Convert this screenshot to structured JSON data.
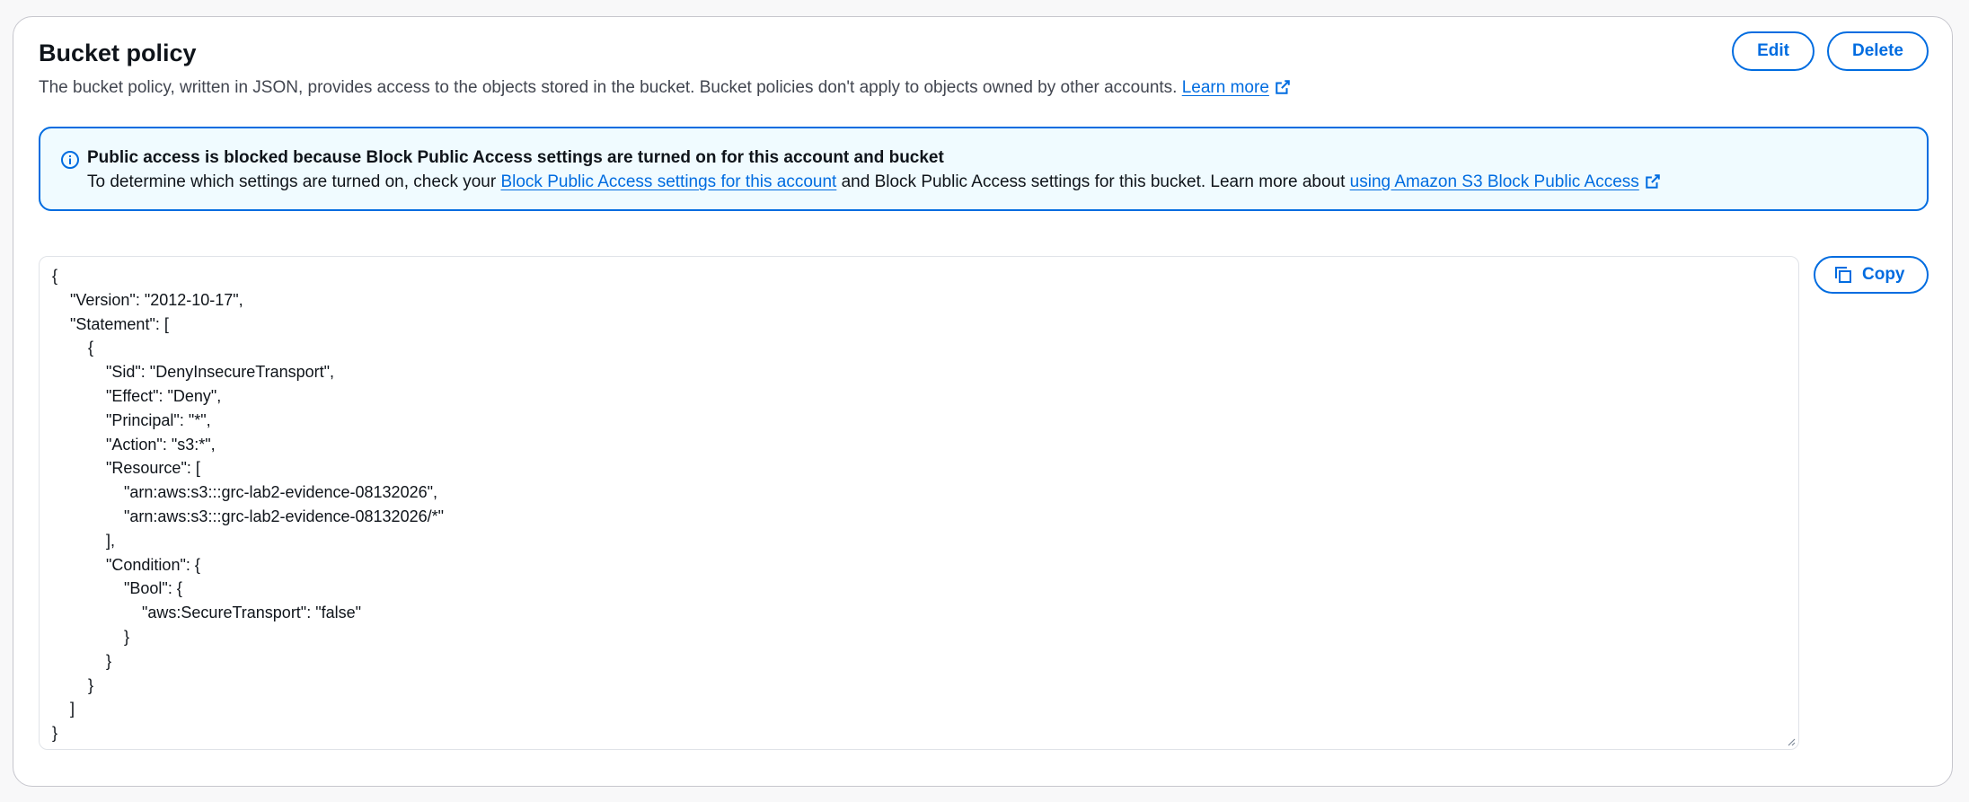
{
  "panel": {
    "title": "Bucket policy",
    "description": "The bucket policy, written in JSON, provides access to the objects stored in the bucket. Bucket policies don't apply to objects owned by other accounts.",
    "learn_more": "Learn more",
    "edit_label": "Edit",
    "delete_label": "Delete"
  },
  "alert": {
    "title": "Public access is blocked because Block Public Access settings are turned on for this account and bucket",
    "body_prefix": "To determine which settings are turned on, check your",
    "link_account": "Block Public Access settings for this account",
    "body_middle": "and Block Public Access settings for this bucket. Learn more about",
    "link_s3": "using Amazon S3 Block Public Access"
  },
  "policy": {
    "json": "{\n    \"Version\": \"2012-10-17\",\n    \"Statement\": [\n        {\n            \"Sid\": \"DenyInsecureTransport\",\n            \"Effect\": \"Deny\",\n            \"Principal\": \"*\",\n            \"Action\": \"s3:*\",\n            \"Resource\": [\n                \"arn:aws:s3:::grc-lab2-evidence-08132026\",\n                \"arn:aws:s3:::grc-lab2-evidence-08132026/*\"\n            ],\n            \"Condition\": {\n                \"Bool\": {\n                    \"aws:SecureTransport\": \"false\"\n                }\n            }\n        }\n    ]\n}",
    "copy_label": "Copy"
  },
  "colors": {
    "accent": "#006ce0",
    "alert_bg": "#f0fbff",
    "text": "#0f141a",
    "muted": "#424650"
  },
  "icons": {
    "external_link": "external-link-icon",
    "info": "info-icon",
    "copy": "copy-icon"
  }
}
